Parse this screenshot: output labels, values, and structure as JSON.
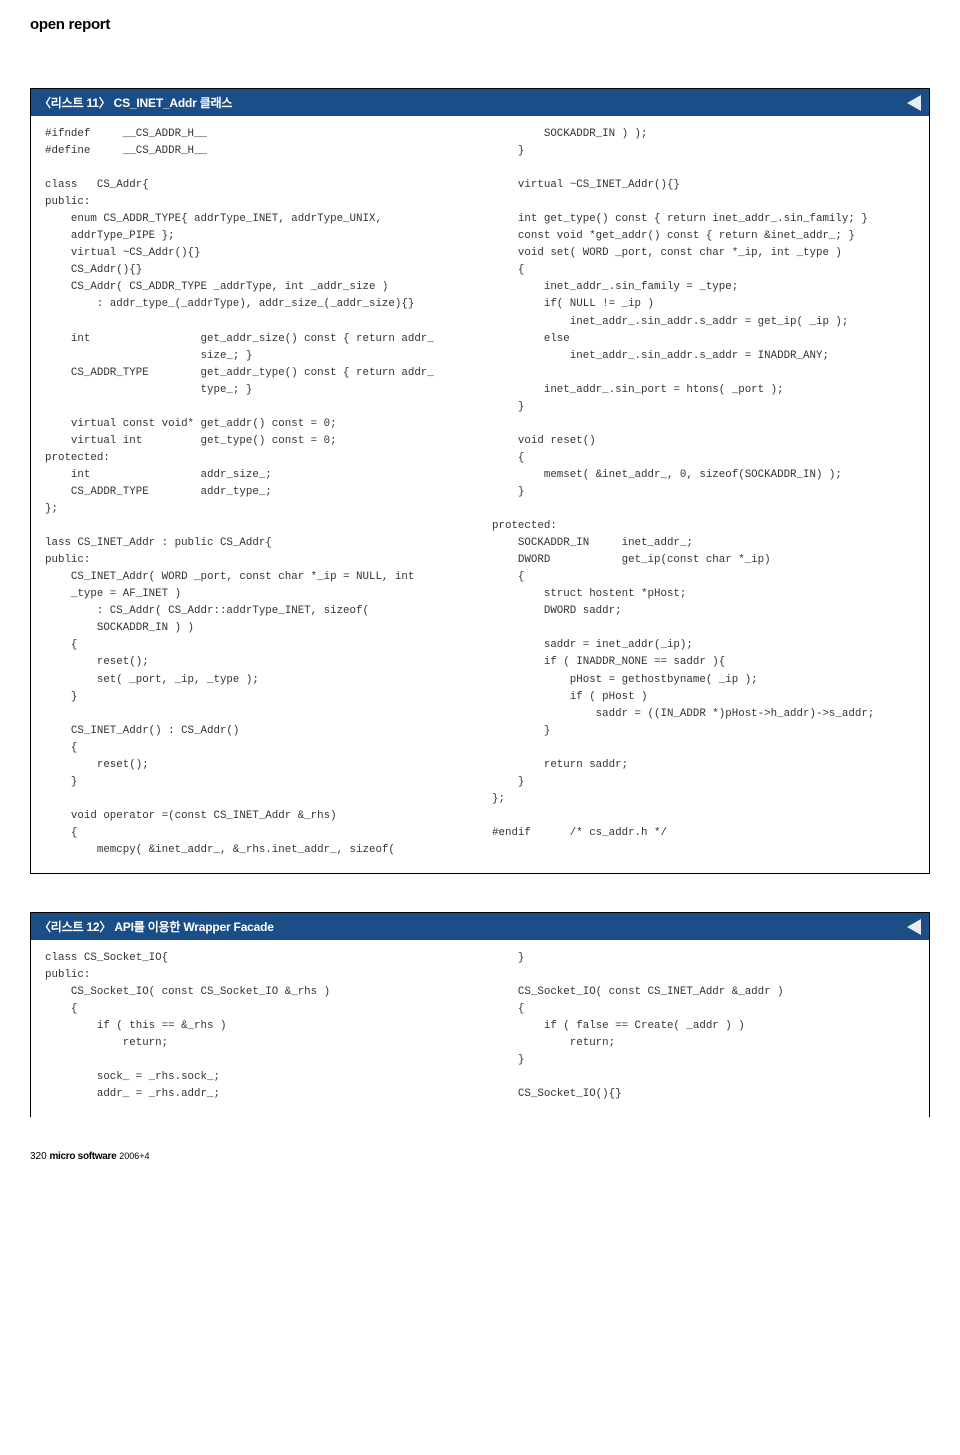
{
  "header": {
    "title": "open report"
  },
  "listing11": {
    "title": "〈리스트 11〉 CS_INET_Addr 클래스",
    "left": "#ifndef     __CS_ADDR_H__\n#define     __CS_ADDR_H__\n\nclass   CS_Addr{\npublic:\n    enum CS_ADDR_TYPE{ addrType_INET, addrType_UNIX,\n    addrType_PIPE };\n    virtual ~CS_Addr(){}\n    CS_Addr(){}\n    CS_Addr( CS_ADDR_TYPE _addrType, int _addr_size )\n        : addr_type_(_addrType), addr_size_(_addr_size){}\n\n    int                 get_addr_size() const { return addr_\n                        size_; }\n    CS_ADDR_TYPE        get_addr_type() const { return addr_\n                        type_; }\n\n    virtual const void* get_addr() const = 0;\n    virtual int         get_type() const = 0;\nprotected:\n    int                 addr_size_;\n    CS_ADDR_TYPE        addr_type_;\n};\n\nlass CS_INET_Addr : public CS_Addr{\npublic:\n    CS_INET_Addr( WORD _port, const char *_ip = NULL, int\n    _type = AF_INET )\n        : CS_Addr( CS_Addr::addrType_INET, sizeof(\n        SOCKADDR_IN ) )\n    {\n        reset();\n        set( _port, _ip, _type );\n    }\n\n    CS_INET_Addr() : CS_Addr()\n    {\n        reset();\n    }\n\n    void operator =(const CS_INET_Addr &_rhs)\n    {\n        memcpy( &inet_addr_, &_rhs.inet_addr_, sizeof(",
    "right": "        SOCKADDR_IN ) );\n    }\n\n    virtual ~CS_INET_Addr(){}\n\n    int get_type() const { return inet_addr_.sin_family; }\n    const void *get_addr() const { return &inet_addr_; }\n    void set( WORD _port, const char *_ip, int _type )\n    {\n        inet_addr_.sin_family = _type;\n        if( NULL != _ip )\n            inet_addr_.sin_addr.s_addr = get_ip( _ip );\n        else\n            inet_addr_.sin_addr.s_addr = INADDR_ANY;\n\n        inet_addr_.sin_port = htons( _port );\n    }\n\n    void reset()\n    {\n        memset( &inet_addr_, 0, sizeof(SOCKADDR_IN) );\n    }\n\nprotected:\n    SOCKADDR_IN     inet_addr_;\n    DWORD           get_ip(const char *_ip)\n    {\n        struct hostent *pHost;\n        DWORD saddr;\n\n        saddr = inet_addr(_ip);\n        if ( INADDR_NONE == saddr ){\n            pHost = gethostbyname( _ip );\n            if ( pHost )\n                saddr = ((IN_ADDR *)pHost->h_addr)->s_addr;\n        }\n\n        return saddr;\n    }\n};\n\n#endif      /* cs_addr.h */"
  },
  "listing12": {
    "title": "〈리스트 12〉 API를 이용한 Wrapper Facade",
    "left": "class CS_Socket_IO{\npublic:\n    CS_Socket_IO( const CS_Socket_IO &_rhs )\n    {\n        if ( this == &_rhs )\n            return;\n\n        sock_ = _rhs.sock_;\n        addr_ = _rhs.addr_;",
    "right": "    }\n\n    CS_Socket_IO( const CS_INET_Addr &_addr )\n    {\n        if ( false == Create( _addr ) )\n            return;\n    }\n\n    CS_Socket_IO(){}"
  },
  "footer": {
    "page": "320",
    "magazine": "micro software",
    "issue": "2006+4"
  }
}
